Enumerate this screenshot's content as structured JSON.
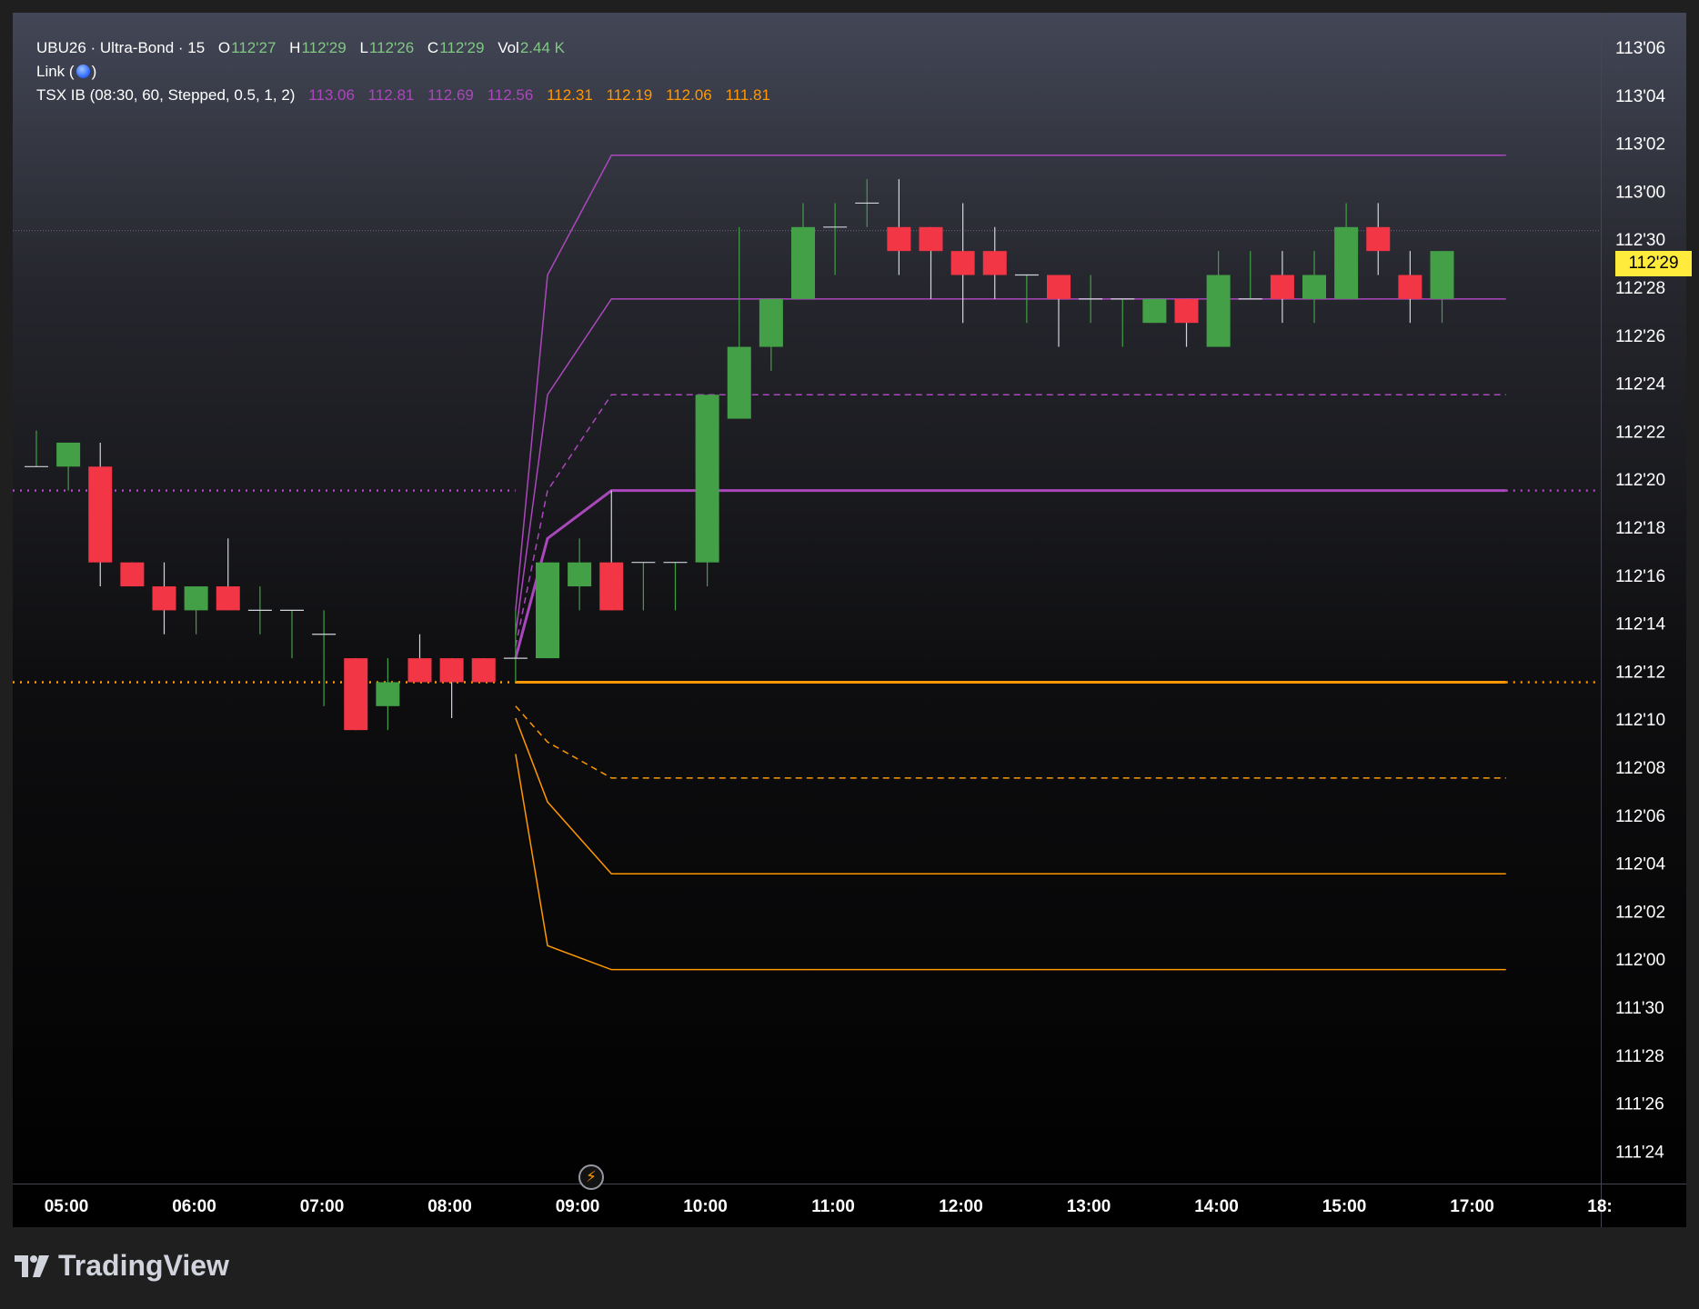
{
  "legend": {
    "symbol": "UBU26 · Ultra-Bond · 15",
    "o_label": "O",
    "o_value": "112'27",
    "h_label": "H",
    "h_value": "112'29",
    "l_label": "L",
    "l_value": "112'26",
    "c_label": "C",
    "c_value": "112'29",
    "vol_label": "Vol",
    "vol_value": "2.44 K",
    "link_label_open": "Link (",
    "link_label_close": ")",
    "indicator_label": "TSX IB (08:30, 60, Stepped, 0.5, 1, 2)",
    "indicator_values": [
      "113.06",
      "112.81",
      "112.69",
      "112.56",
      "112.31",
      "112.19",
      "112.06",
      "111.81"
    ]
  },
  "colors": {
    "up": "#43a047",
    "down": "#f23645",
    "upper": "#ab47bc",
    "lower": "#ff9800",
    "legend_green": "#81c784",
    "legend_purple": "#ab47bc",
    "legend_orange": "#ff9800",
    "axis_text": "#ffffff",
    "current_price_tag": "#ffeb3b"
  },
  "current_price": "112'29",
  "icons": {
    "event": "lightning-bolt-icon",
    "logo": "tradingview-logo-icon"
  },
  "footer": {
    "brand": "TradingView"
  },
  "chart_data": {
    "type": "candlestick",
    "x_ticks": [
      "05:00",
      "06:00",
      "07:00",
      "08:00",
      "09:00",
      "10:00",
      "11:00",
      "12:00",
      "13:00",
      "14:00",
      "15:00",
      "17:00",
      "18:"
    ],
    "y_ticks": [
      "113'06",
      "113'04",
      "113'02",
      "113'00",
      "112'30",
      "112'28",
      "112'26",
      "112'24",
      "112'22",
      "112'20",
      "112'18",
      "112'16",
      "112'14",
      "112'12",
      "112'10",
      "112'08",
      "112'06",
      "112'04",
      "112'02",
      "112'00",
      "111'30",
      "111'28",
      "111'26",
      "111'24"
    ],
    "ylim_ticks_32nds": [
      2654,
      2702
    ],
    "price_units": "32nds of a point (113'06 = 113 + 6/32)",
    "candles_32nds": [
      {
        "t": "04:45",
        "o": 3599.5,
        "h": 3601,
        "l": 3599.5,
        "c": 3599.5
      },
      {
        "t": "05:00",
        "o": 3599.5,
        "h": 3600.5,
        "l": 3598.5,
        "c": 3600.5
      },
      {
        "t": "05:15",
        "o": 3599.5,
        "h": 3600.5,
        "l": 3594.5,
        "c": 3595.5
      },
      {
        "t": "05:30",
        "o": 3595.5,
        "h": 3595.5,
        "l": 3594.5,
        "c": 3594.5
      },
      {
        "t": "05:45",
        "o": 3594.5,
        "h": 3595.5,
        "l": 3592.5,
        "c": 3593.5
      },
      {
        "t": "06:00",
        "o": 3593.5,
        "h": 3594.5,
        "l": 3592.5,
        "c": 3594.5
      },
      {
        "t": "06:15",
        "o": 3594.5,
        "h": 3596.5,
        "l": 3593.5,
        "c": 3593.5
      },
      {
        "t": "06:30",
        "o": 3593.5,
        "h": 3594.5,
        "l": 3592.5,
        "c": 3593.5
      },
      {
        "t": "06:45",
        "o": 3593.5,
        "h": 3593.5,
        "l": 3591.5,
        "c": 3593.5
      },
      {
        "t": "07:00",
        "o": 3592.5,
        "h": 3593.5,
        "l": 3589.5,
        "c": 3592.5
      },
      {
        "t": "07:15",
        "o": 3591.5,
        "h": 3591.5,
        "l": 3588.5,
        "c": 3588.5
      },
      {
        "t": "07:30",
        "o": 3589.5,
        "h": 3591.5,
        "l": 3588.5,
        "c": 3590.5
      },
      {
        "t": "07:45",
        "o": 3591.5,
        "h": 3592.5,
        "l": 3590.5,
        "c": 3590.5
      },
      {
        "t": "08:00",
        "o": 3591.5,
        "h": 3591.5,
        "l": 3589,
        "c": 3590.5
      },
      {
        "t": "08:15",
        "o": 3591.5,
        "h": 3591.5,
        "l": 3590.5,
        "c": 3590.5
      },
      {
        "t": "08:30",
        "o": 3591.5,
        "h": 3593.5,
        "l": 3590.5,
        "c": 3591.5
      },
      {
        "t": "08:45",
        "o": 3591.5,
        "h": 3595.5,
        "l": 3591.5,
        "c": 3595.5
      },
      {
        "t": "09:00",
        "o": 3594.5,
        "h": 3596.5,
        "l": 3593.5,
        "c": 3595.5
      },
      {
        "t": "09:15",
        "o": 3595.5,
        "h": 3598.5,
        "l": 3593.5,
        "c": 3593.5
      },
      {
        "t": "09:30",
        "o": 3595.5,
        "h": 3595.5,
        "l": 3593.5,
        "c": 3595.5
      },
      {
        "t": "09:45",
        "o": 3595.5,
        "h": 3595.5,
        "l": 3593.5,
        "c": 3595.5
      },
      {
        "t": "10:00",
        "o": 3595.5,
        "h": 3602.5,
        "l": 3594.5,
        "c": 3602.5
      },
      {
        "t": "10:15",
        "o": 3601.5,
        "h": 3609.5,
        "l": 3601.5,
        "c": 3604.5
      },
      {
        "t": "10:30",
        "o": 3604.5,
        "h": 3606.5,
        "l": 3603.5,
        "c": 3606.5
      },
      {
        "t": "10:45",
        "o": 3606.5,
        "h": 3610.5,
        "l": 3606.5,
        "c": 3609.5
      },
      {
        "t": "11:00",
        "o": 3609.5,
        "h": 3610.5,
        "l": 3607.5,
        "c": 3609.5
      },
      {
        "t": "11:15",
        "o": 3610.5,
        "h": 3611.5,
        "l": 3609.5,
        "c": 3610.5
      },
      {
        "t": "11:30",
        "o": 3609.5,
        "h": 3611.5,
        "l": 3607.5,
        "c": 3608.5
      },
      {
        "t": "11:45",
        "o": 3609.5,
        "h": 3609.5,
        "l": 3606.5,
        "c": 3608.5
      },
      {
        "t": "12:00",
        "o": 3608.5,
        "h": 3610.5,
        "l": 3605.5,
        "c": 3607.5
      },
      {
        "t": "12:15",
        "o": 3608.5,
        "h": 3609.5,
        "l": 3606.5,
        "c": 3607.5
      },
      {
        "t": "12:30",
        "o": 3607.5,
        "h": 3607.5,
        "l": 3605.5,
        "c": 3607.5
      },
      {
        "t": "12:45",
        "o": 3607.5,
        "h": 3607.5,
        "l": 3604.5,
        "c": 3606.5
      },
      {
        "t": "13:00",
        "o": 3606.5,
        "h": 3607.5,
        "l": 3605.5,
        "c": 3606.5
      },
      {
        "t": "13:15",
        "o": 3606.5,
        "h": 3606.5,
        "l": 3604.5,
        "c": 3606.5
      },
      {
        "t": "13:30",
        "o": 3605.5,
        "h": 3606.5,
        "l": 3605.5,
        "c": 3606.5
      },
      {
        "t": "13:45",
        "o": 3606.5,
        "h": 3606.5,
        "l": 3604.5,
        "c": 3605.5
      },
      {
        "t": "14:00",
        "o": 3604.5,
        "h": 3608.5,
        "l": 3604.5,
        "c": 3607.5
      },
      {
        "t": "14:15",
        "o": 3606.5,
        "h": 3608.5,
        "l": 3606.5,
        "c": 3606.5
      },
      {
        "t": "14:30",
        "o": 3607.5,
        "h": 3608.5,
        "l": 3605.5,
        "c": 3606.5
      },
      {
        "t": "14:45",
        "o": 3606.5,
        "h": 3608.5,
        "l": 3605.5,
        "c": 3607.5
      },
      {
        "t": "15:00",
        "o": 3606.5,
        "h": 3610.5,
        "l": 3606.5,
        "c": 3609.5
      },
      {
        "t": "15:15",
        "o": 3609.5,
        "h": 3610.5,
        "l": 3607.5,
        "c": 3608.5
      },
      {
        "t": "15:30",
        "o": 3607.5,
        "h": 3608.5,
        "l": 3605.5,
        "c": 3606.5
      },
      {
        "t": "15:45",
        "o": 3606.5,
        "h": 3608.5,
        "l": 3605.5,
        "c": 3608.5
      }
    ],
    "ib_levels": [
      {
        "name": "upper_2",
        "value": "113.06",
        "color": "upper",
        "style": "solid",
        "steps": [
          3593.5,
          3607.5,
          3612.5
        ]
      },
      {
        "name": "upper_1",
        "value": "112.81",
        "color": "upper",
        "style": "solid",
        "steps": [
          3592.5,
          3602.5,
          3606.5
        ]
      },
      {
        "name": "upper_0.5",
        "value": "112.69",
        "color": "upper",
        "style": "dashed",
        "steps": [
          3592,
          3598.5,
          3602.5
        ]
      },
      {
        "name": "ib_high",
        "value": "112.56",
        "color": "upper",
        "style": "thick",
        "steps": [
          3591.5,
          3596.5,
          3598.5
        ],
        "extended": true
      },
      {
        "name": "ib_low",
        "value": "112.31",
        "color": "lower",
        "style": "thick",
        "steps": [
          3590.5,
          3590.5,
          3590.5
        ],
        "extended": true
      },
      {
        "name": "lower_0.5",
        "value": "112.19",
        "color": "lower",
        "style": "dashed",
        "steps": [
          3589.5,
          3588,
          3586.5
        ]
      },
      {
        "name": "lower_1",
        "value": "112.06",
        "color": "lower",
        "style": "solid",
        "steps": [
          3589,
          3585.5,
          3582.5
        ]
      },
      {
        "name": "lower_2",
        "value": "111.81",
        "color": "lower",
        "style": "solid",
        "steps": [
          3587.5,
          3579.5,
          3578.5
        ]
      }
    ]
  }
}
